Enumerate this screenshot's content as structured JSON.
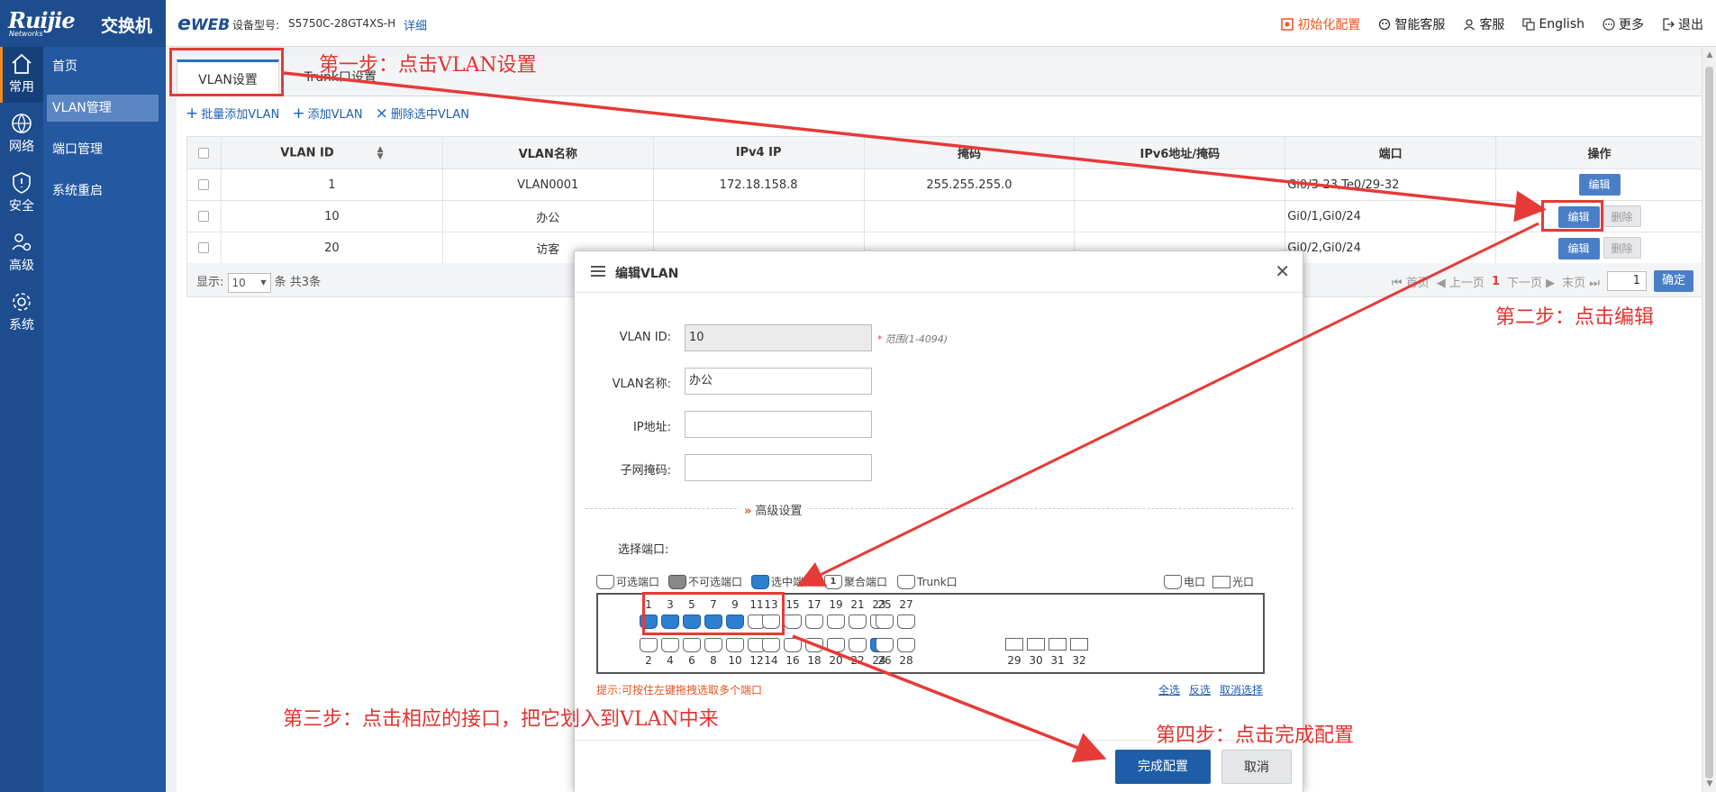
{
  "brand": {
    "logo": "Ruijie",
    "sub": "Networks",
    "title": "交换机"
  },
  "header": {
    "eweb": "WEB",
    "model_label": "设备型号:",
    "model_value": "S5750C-28GT4XS-H",
    "detail": "详细",
    "nav": [
      {
        "label": "初始化配置",
        "icon": "init-config-icon"
      },
      {
        "label": "智能客服",
        "icon": "smart-service-icon"
      },
      {
        "label": "客服",
        "icon": "service-icon"
      },
      {
        "label": "English",
        "icon": "language-icon"
      },
      {
        "label": "更多",
        "icon": "more-icon"
      },
      {
        "label": "退出",
        "icon": "logout-icon"
      }
    ]
  },
  "rail": [
    {
      "label": "常用",
      "icon": "home-icon"
    },
    {
      "label": "网络",
      "icon": "network-icon"
    },
    {
      "label": "安全",
      "icon": "shield-icon"
    },
    {
      "label": "高级",
      "icon": "advanced-users-icon"
    },
    {
      "label": "系统",
      "icon": "gear-icon"
    }
  ],
  "subnav": [
    "首页",
    "VLAN管理",
    "端口管理",
    "系统重启"
  ],
  "tabs": [
    "VLAN设置",
    "Trunk口设置"
  ],
  "toolbar": {
    "batch_add": "批量添加VLAN",
    "add": "添加VLAN",
    "delete_selected": "删除选中VLAN"
  },
  "table": {
    "headers": [
      "VLAN ID",
      "VLAN名称",
      "IPv4 IP",
      "掩码",
      "IPv6地址/掩码",
      "端口",
      "操作"
    ],
    "rows": [
      {
        "id": "1",
        "name": "VLAN0001",
        "ipv4": "172.18.158.8",
        "mask": "255.255.255.0",
        "ipv6": "",
        "ports": "Gi0/3-23,Te0/29-32"
      },
      {
        "id": "10",
        "name": "办公",
        "ipv4": "",
        "mask": "",
        "ipv6": "",
        "ports": "Gi0/1,Gi0/24"
      },
      {
        "id": "20",
        "name": "访客",
        "ipv4": "",
        "mask": "",
        "ipv6": "",
        "ports": "Gi0/2,Gi0/24"
      }
    ],
    "edit_label": "编辑",
    "delete_label": "删除"
  },
  "footer": {
    "show_label": "显示:",
    "page_size": "10",
    "count_text": "条 共3条",
    "first": "首页",
    "prev": "上一页",
    "current": "1",
    "next": "下一页",
    "last": "末页",
    "page_input": "1",
    "confirm": "确定"
  },
  "dialog": {
    "title": "编辑VLAN",
    "vlan_id_label": "VLAN ID:",
    "vlan_id_value": "10",
    "vlan_id_hint": "范围(1-4094)",
    "vlan_name_label": "VLAN名称:",
    "vlan_name_value": "办公",
    "ip_label": "IP地址:",
    "mask_label": "子网掩码:",
    "advanced": "高级设置",
    "select_ports": "选择端口:",
    "legend": {
      "selectable": "可选端口",
      "unselectable": "不可选端口",
      "selected": "选中端口",
      "aggregate": "聚合端口",
      "trunk": "Trunk口",
      "aggregate_mark": "1",
      "copper": "电口",
      "fiber": "光口"
    },
    "ports": {
      "top_odd": [
        "1",
        "3",
        "5",
        "7",
        "9",
        "11",
        "13",
        "15",
        "17",
        "19",
        "21",
        "23",
        "25",
        "27"
      ],
      "bottom_even": [
        "2",
        "4",
        "6",
        "8",
        "10",
        "12",
        "14",
        "16",
        "18",
        "20",
        "22",
        "24",
        "26",
        "28"
      ],
      "fiber": [
        "29",
        "30",
        "31",
        "32"
      ],
      "selected": [
        "1",
        "3",
        "5",
        "7",
        "9",
        "24"
      ]
    },
    "hint_prefix": "提示:",
    "hint": "可按住左键拖拽选取多个端口",
    "select_all": "全选",
    "invert": "反选",
    "clear": "取消选择",
    "finish": "完成配置",
    "cancel": "取消"
  },
  "annotations": {
    "step1": "第一步：点击VLAN设置",
    "step2": "第二步：点击编辑",
    "step3": "第三步：点击相应的接口，把它划入到VLAN中来",
    "step4": "第四步：点击完成配置"
  }
}
